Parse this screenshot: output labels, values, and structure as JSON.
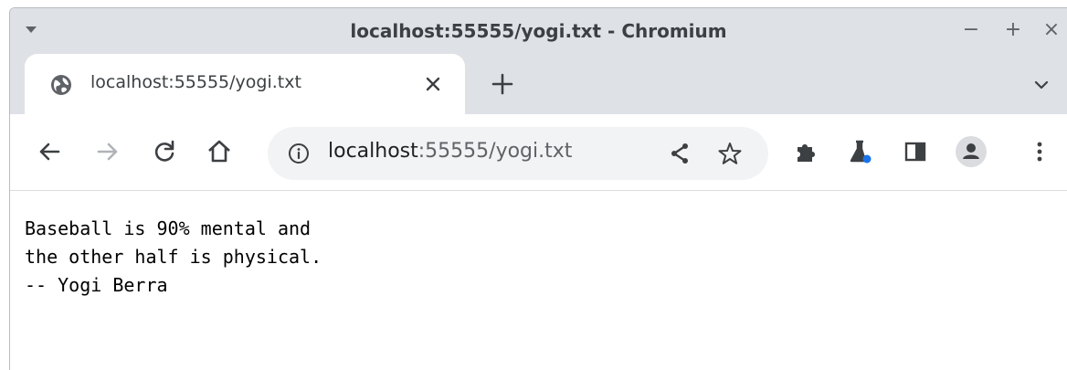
{
  "window": {
    "title": "localhost:55555/yogi.txt - Chromium",
    "controls": [
      "−",
      "+",
      "×"
    ]
  },
  "tab": {
    "title": "localhost:55555/yogi.txt",
    "favicon": "globe-icon"
  },
  "toolbar": {
    "url_host": "localhost",
    "url_path": ":55555/yogi.txt",
    "icons": [
      "back-icon",
      "forward-icon",
      "reload-icon",
      "home-icon",
      "info-icon",
      "share-icon",
      "star-icon",
      "extensions-icon",
      "labs-icon",
      "side-panel-icon",
      "profile-icon",
      "menu-icon"
    ]
  },
  "content": {
    "lines": [
      "Baseball is 90% mental and",
      "the other half is physical.",
      "-- Yogi Berra"
    ]
  },
  "colors": {
    "chrome_bg": "#dee1e6",
    "omnibox_bg": "#f1f3f4",
    "icon": "#5f6368",
    "accent": "#1a73e8"
  }
}
